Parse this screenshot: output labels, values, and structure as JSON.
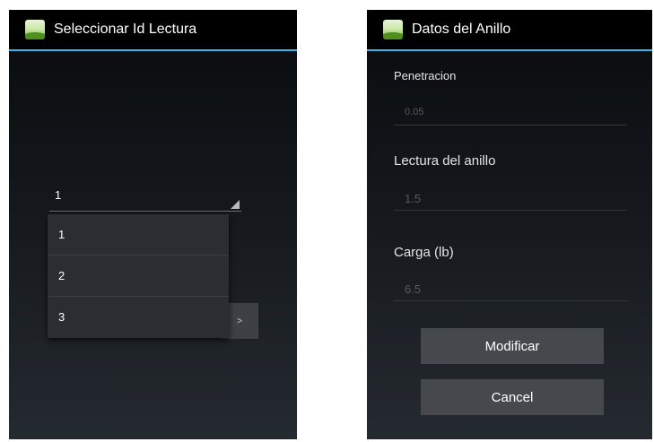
{
  "left_screen": {
    "title": "Seleccionar Id Lectura",
    "spinner": {
      "selected": "1"
    },
    "dropdown": {
      "options": [
        "1",
        "2",
        "3"
      ]
    },
    "next_button": {
      "label": ">"
    }
  },
  "right_screen": {
    "title": "Datos del Anillo",
    "fields": [
      {
        "label": "Penetracion",
        "value": "0.05"
      },
      {
        "label": "Lectura del anillo",
        "value": "1.5"
      },
      {
        "label": "Carga (lb)",
        "value": "6.5"
      }
    ],
    "buttons": {
      "modify": "Modificar",
      "cancel": "Cancel"
    }
  },
  "colors": {
    "action_bar_underline": "#33b5e5",
    "background": "#14181c",
    "button": "#45494e"
  },
  "icons": [
    "app-icon"
  ]
}
